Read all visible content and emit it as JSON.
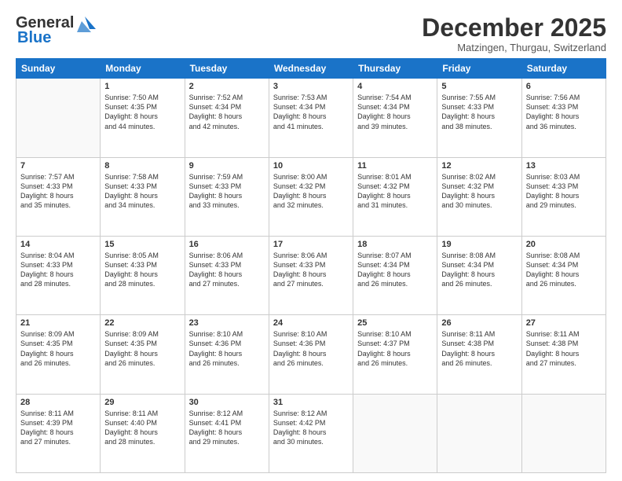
{
  "logo": {
    "line1": "General",
    "line2": "Blue"
  },
  "title": "December 2025",
  "location": "Matzingen, Thurgau, Switzerland",
  "weekdays": [
    "Sunday",
    "Monday",
    "Tuesday",
    "Wednesday",
    "Thursday",
    "Friday",
    "Saturday"
  ],
  "weeks": [
    [
      {
        "day": "",
        "text": ""
      },
      {
        "day": "1",
        "text": "Sunrise: 7:50 AM\nSunset: 4:35 PM\nDaylight: 8 hours\nand 44 minutes."
      },
      {
        "day": "2",
        "text": "Sunrise: 7:52 AM\nSunset: 4:34 PM\nDaylight: 8 hours\nand 42 minutes."
      },
      {
        "day": "3",
        "text": "Sunrise: 7:53 AM\nSunset: 4:34 PM\nDaylight: 8 hours\nand 41 minutes."
      },
      {
        "day": "4",
        "text": "Sunrise: 7:54 AM\nSunset: 4:34 PM\nDaylight: 8 hours\nand 39 minutes."
      },
      {
        "day": "5",
        "text": "Sunrise: 7:55 AM\nSunset: 4:33 PM\nDaylight: 8 hours\nand 38 minutes."
      },
      {
        "day": "6",
        "text": "Sunrise: 7:56 AM\nSunset: 4:33 PM\nDaylight: 8 hours\nand 36 minutes."
      }
    ],
    [
      {
        "day": "7",
        "text": "Sunrise: 7:57 AM\nSunset: 4:33 PM\nDaylight: 8 hours\nand 35 minutes."
      },
      {
        "day": "8",
        "text": "Sunrise: 7:58 AM\nSunset: 4:33 PM\nDaylight: 8 hours\nand 34 minutes."
      },
      {
        "day": "9",
        "text": "Sunrise: 7:59 AM\nSunset: 4:33 PM\nDaylight: 8 hours\nand 33 minutes."
      },
      {
        "day": "10",
        "text": "Sunrise: 8:00 AM\nSunset: 4:32 PM\nDaylight: 8 hours\nand 32 minutes."
      },
      {
        "day": "11",
        "text": "Sunrise: 8:01 AM\nSunset: 4:32 PM\nDaylight: 8 hours\nand 31 minutes."
      },
      {
        "day": "12",
        "text": "Sunrise: 8:02 AM\nSunset: 4:32 PM\nDaylight: 8 hours\nand 30 minutes."
      },
      {
        "day": "13",
        "text": "Sunrise: 8:03 AM\nSunset: 4:33 PM\nDaylight: 8 hours\nand 29 minutes."
      }
    ],
    [
      {
        "day": "14",
        "text": "Sunrise: 8:04 AM\nSunset: 4:33 PM\nDaylight: 8 hours\nand 28 minutes."
      },
      {
        "day": "15",
        "text": "Sunrise: 8:05 AM\nSunset: 4:33 PM\nDaylight: 8 hours\nand 28 minutes."
      },
      {
        "day": "16",
        "text": "Sunrise: 8:06 AM\nSunset: 4:33 PM\nDaylight: 8 hours\nand 27 minutes."
      },
      {
        "day": "17",
        "text": "Sunrise: 8:06 AM\nSunset: 4:33 PM\nDaylight: 8 hours\nand 27 minutes."
      },
      {
        "day": "18",
        "text": "Sunrise: 8:07 AM\nSunset: 4:34 PM\nDaylight: 8 hours\nand 26 minutes."
      },
      {
        "day": "19",
        "text": "Sunrise: 8:08 AM\nSunset: 4:34 PM\nDaylight: 8 hours\nand 26 minutes."
      },
      {
        "day": "20",
        "text": "Sunrise: 8:08 AM\nSunset: 4:34 PM\nDaylight: 8 hours\nand 26 minutes."
      }
    ],
    [
      {
        "day": "21",
        "text": "Sunrise: 8:09 AM\nSunset: 4:35 PM\nDaylight: 8 hours\nand 26 minutes."
      },
      {
        "day": "22",
        "text": "Sunrise: 8:09 AM\nSunset: 4:35 PM\nDaylight: 8 hours\nand 26 minutes."
      },
      {
        "day": "23",
        "text": "Sunrise: 8:10 AM\nSunset: 4:36 PM\nDaylight: 8 hours\nand 26 minutes."
      },
      {
        "day": "24",
        "text": "Sunrise: 8:10 AM\nSunset: 4:36 PM\nDaylight: 8 hours\nand 26 minutes."
      },
      {
        "day": "25",
        "text": "Sunrise: 8:10 AM\nSunset: 4:37 PM\nDaylight: 8 hours\nand 26 minutes."
      },
      {
        "day": "26",
        "text": "Sunrise: 8:11 AM\nSunset: 4:38 PM\nDaylight: 8 hours\nand 26 minutes."
      },
      {
        "day": "27",
        "text": "Sunrise: 8:11 AM\nSunset: 4:38 PM\nDaylight: 8 hours\nand 27 minutes."
      }
    ],
    [
      {
        "day": "28",
        "text": "Sunrise: 8:11 AM\nSunset: 4:39 PM\nDaylight: 8 hours\nand 27 minutes."
      },
      {
        "day": "29",
        "text": "Sunrise: 8:11 AM\nSunset: 4:40 PM\nDaylight: 8 hours\nand 28 minutes."
      },
      {
        "day": "30",
        "text": "Sunrise: 8:12 AM\nSunset: 4:41 PM\nDaylight: 8 hours\nand 29 minutes."
      },
      {
        "day": "31",
        "text": "Sunrise: 8:12 AM\nSunset: 4:42 PM\nDaylight: 8 hours\nand 30 minutes."
      },
      {
        "day": "",
        "text": ""
      },
      {
        "day": "",
        "text": ""
      },
      {
        "day": "",
        "text": ""
      }
    ]
  ]
}
